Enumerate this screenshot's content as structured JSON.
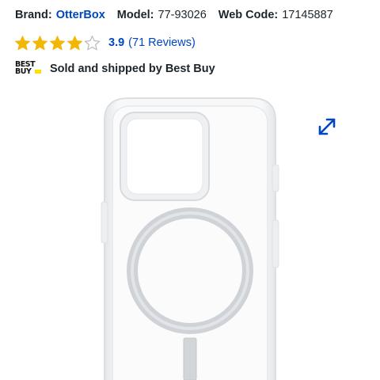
{
  "product": {
    "brand_label": "Brand:",
    "brand_value": "OtterBox",
    "model_label": "Model:",
    "model_value": "77-93026",
    "webcode_label": "Web Code:",
    "webcode_value": "17145887"
  },
  "rating": {
    "value": "3.9",
    "reviews": "(71 Reviews)",
    "stars_filled": 3.9,
    "stars_total": 5
  },
  "seller": {
    "logo_text": "BEST BUY",
    "text": "Sold and shipped by Best Buy"
  },
  "icons": {
    "star": "star-icon",
    "expand": "expand-arrows-icon",
    "logo": "best-buy-logo"
  },
  "colors": {
    "link_blue": "#0046be",
    "star_gold": "#f2b705",
    "logo_yellow": "#ffe000",
    "text": "#1d252c"
  }
}
